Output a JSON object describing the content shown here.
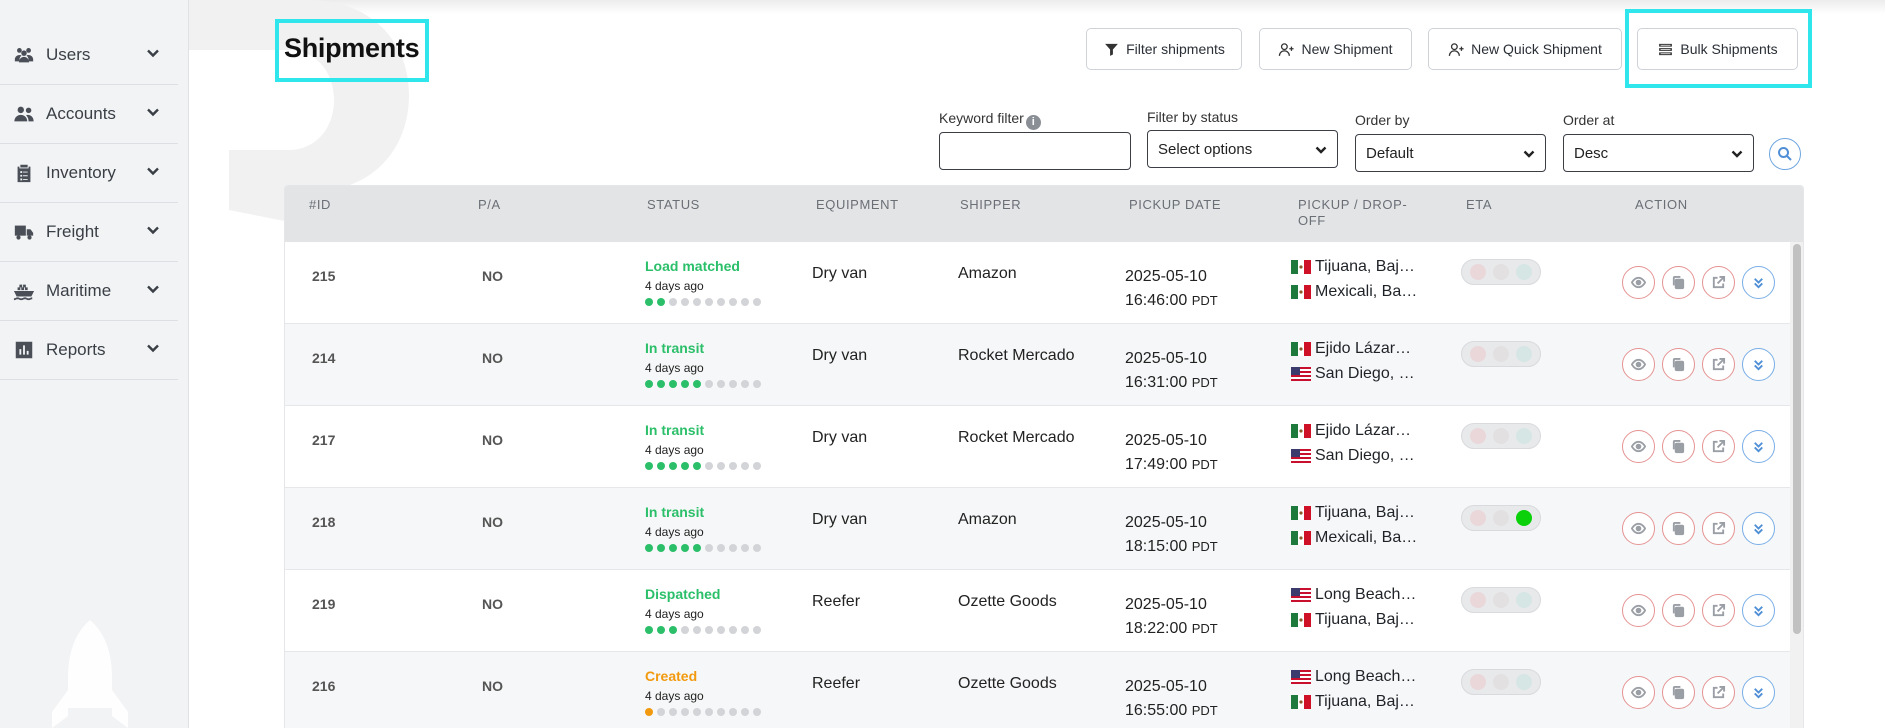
{
  "sidebar": {
    "items": [
      {
        "label": "Users",
        "icon": "users-icon"
      },
      {
        "label": "Accounts",
        "icon": "accounts-icon"
      },
      {
        "label": "Inventory",
        "icon": "clipboard-icon"
      },
      {
        "label": "Freight",
        "icon": "truck-icon"
      },
      {
        "label": "Maritime",
        "icon": "ship-icon"
      },
      {
        "label": "Reports",
        "icon": "chart-icon"
      }
    ]
  },
  "header": {
    "title": "Shipments",
    "buttons": {
      "filter": "Filter shipments",
      "new": "New Shipment",
      "quick": "New Quick Shipment",
      "bulk": "Bulk Shipments"
    }
  },
  "filters": {
    "keyword_label": "Keyword filter",
    "keyword_value": "",
    "status_label": "Filter by status",
    "status_value": "Select options",
    "order_by_label": "Order by",
    "order_by_value": "Default",
    "order_at_label": "Order at",
    "order_at_value": "Desc"
  },
  "table": {
    "headers": [
      "#ID",
      "P/A",
      "STATUS",
      "EQUIPMENT",
      "SHIPPER",
      "PICKUP DATE",
      "PICKUP / DROP-OFF",
      "ETA",
      "ACTION"
    ],
    "rows": [
      {
        "id": "215",
        "pa": "NO",
        "status": "Load matched",
        "status_color": "#2bbf6a",
        "ago": "4 days ago",
        "progress": 2,
        "equipment": "Dry van",
        "shipper": "Amazon",
        "date": "2025-05-10",
        "time": "16:46:00",
        "tz": "PDT",
        "pickup": "Tijuana, Baja California",
        "pickup_flag": "mx",
        "dropoff": "Mexicali, Baja California",
        "dropoff_flag": "mx",
        "eta": "none"
      },
      {
        "id": "214",
        "pa": "NO",
        "status": "In transit",
        "status_color": "#2bbf6a",
        "ago": "4 days ago",
        "progress": 5,
        "equipment": "Dry van",
        "shipper": "Rocket Mercado",
        "date": "2025-05-10",
        "time": "16:31:00",
        "tz": "PDT",
        "pickup": "Ejido Lázaro Cárdenas",
        "pickup_flag": "mx",
        "dropoff": "San Diego, California",
        "dropoff_flag": "us",
        "eta": "none"
      },
      {
        "id": "217",
        "pa": "NO",
        "status": "In transit",
        "status_color": "#2bbf6a",
        "ago": "4 days ago",
        "progress": 5,
        "equipment": "Dry van",
        "shipper": "Rocket Mercado",
        "date": "2025-05-10",
        "time": "17:49:00",
        "tz": "PDT",
        "pickup": "Ejido Lázaro Cárdenas",
        "pickup_flag": "mx",
        "dropoff": "San Diego, California",
        "dropoff_flag": "us",
        "eta": "none"
      },
      {
        "id": "218",
        "pa": "NO",
        "status": "In transit",
        "status_color": "#2bbf6a",
        "ago": "4 days ago",
        "progress": 5,
        "equipment": "Dry van",
        "shipper": "Amazon",
        "date": "2025-05-10",
        "time": "18:15:00",
        "tz": "PDT",
        "pickup": "Tijuana, Baja California",
        "pickup_flag": "mx",
        "dropoff": "Mexicali, Baja California",
        "dropoff_flag": "mx",
        "eta": "green"
      },
      {
        "id": "219",
        "pa": "NO",
        "status": "Dispatched",
        "status_color": "#2bbf6a",
        "ago": "4 days ago",
        "progress": 3,
        "equipment": "Reefer",
        "shipper": "Ozette Goods",
        "date": "2025-05-10",
        "time": "18:22:00",
        "tz": "PDT",
        "pickup": "Long Beach, California",
        "pickup_flag": "us",
        "dropoff": "Tijuana, Baja California",
        "dropoff_flag": "mx",
        "eta": "none"
      },
      {
        "id": "216",
        "pa": "NO",
        "status": "Created",
        "status_color": "#f29a0f",
        "ago": "4 days ago",
        "progress": 1,
        "equipment": "Reefer",
        "shipper": "Ozette Goods",
        "date": "2025-05-10",
        "time": "16:55:00",
        "tz": "PDT",
        "pickup": "Long Beach, California",
        "pickup_flag": "us",
        "dropoff": "Tijuana, Baja California",
        "dropoff_flag": "mx",
        "eta": "none"
      }
    ]
  },
  "colors": {
    "accent_highlight": "#2ee6ec",
    "status_green": "#2bbf6a",
    "status_orange": "#f29a0f",
    "action_red": "#e59393",
    "action_blue": "#4f8fd6"
  }
}
